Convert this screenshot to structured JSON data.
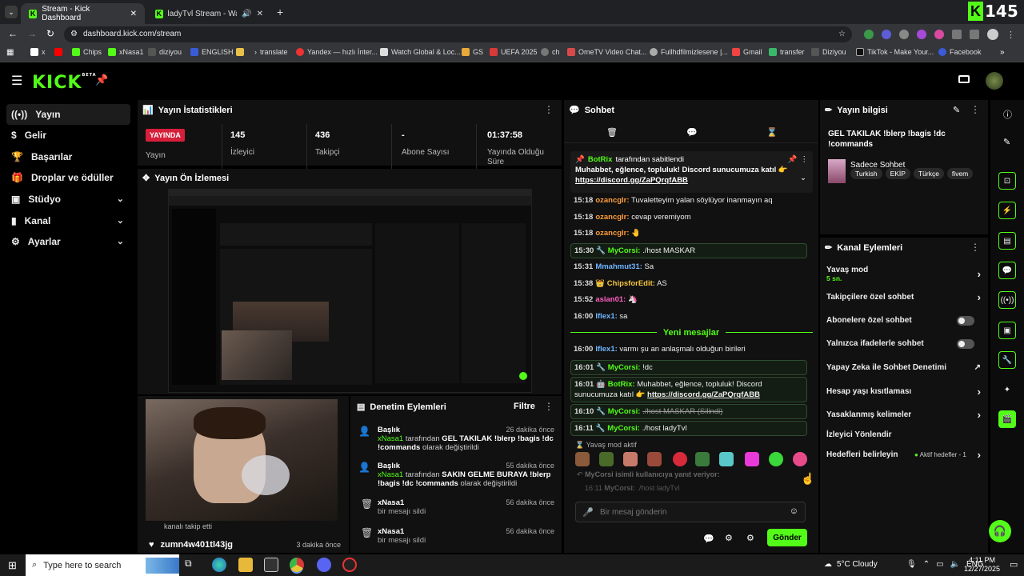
{
  "browser": {
    "tabs": [
      {
        "title": "Stream - Kick Dashboard"
      },
      {
        "title": "ladyTvl Stream - Watch Live"
      }
    ],
    "url": "dashboard.kick.com/stream",
    "bookmarks": [
      "x",
      "Chips",
      "xNasa1",
      "diziyou",
      "ENGLISH",
      "translate",
      "Yandex — hızlı İnter...",
      "Watch Global & Loc...",
      "GS",
      "UEFA 2025",
      "ch",
      "OmeTV Video Chat...",
      "Fullhdfilmizlesene |...",
      "Gmail",
      "transfer",
      "Diziyou",
      "TikTok - Make Your...",
      "Facebook"
    ],
    "viewer_overlay": "145"
  },
  "header": {
    "logo": "KICK",
    "logo_sup": "BETA"
  },
  "nav": {
    "items": [
      {
        "label": "Yayın"
      },
      {
        "label": "Gelir"
      },
      {
        "label": "Başarılar"
      },
      {
        "label": "Droplar ve ödüller"
      },
      {
        "label": "Stüdyo"
      },
      {
        "label": "Kanal"
      },
      {
        "label": "Ayarlar"
      }
    ]
  },
  "stats": {
    "title": "Yayın İstatistikleri",
    "live_badge": "YAYINDA",
    "live_label": "Yayın",
    "cols": [
      {
        "value": "145",
        "label": "İzleyici"
      },
      {
        "value": "436",
        "label": "Takipçi"
      },
      {
        "value": "-",
        "label": "Abone Sayısı"
      },
      {
        "value": "01:37:58",
        "label": "Yayında Olduğu Süre"
      }
    ]
  },
  "preview": {
    "title": "Yayın Ön İzlemesi"
  },
  "feed": {
    "follow_text": "kanalı takip etti",
    "follower": "zumn4w401tl43jg",
    "time": "3 dakika önce"
  },
  "moderation": {
    "title": "Denetim Eylemleri",
    "filter": "Filtre",
    "rows": [
      {
        "head": "Başlık",
        "time": "26 dakika önce",
        "user": "xNasa1",
        "pre": "tarafından",
        "text": "GEL TAKILAK !blerp !bagis !dc !commands",
        "post": "olarak değiştirildi"
      },
      {
        "head": "Başlık",
        "time": "55 dakika önce",
        "user": "xNasa1",
        "pre": "tarafından",
        "text": "SAKIN GELME BURAYA !blerp !bagis !dc !commands",
        "post": "olarak değiştirildi"
      },
      {
        "head": "xNasa1",
        "time": "56 dakika önce",
        "sub": "bir mesajı sildi"
      },
      {
        "head": "xNasa1",
        "time": "56 dakika önce",
        "sub": "bir mesajı sildi"
      }
    ]
  },
  "chat": {
    "title": "Sohbet",
    "pinned_user": "BotRix",
    "pinned_by": "tarafından sabitlendi",
    "pinned_text": "Muhabbet, eğlence, topluluk! Discord sunucumuza katıl 👉",
    "pinned_link": "https://discord.gg/ZaPQrqfABB",
    "messages": [
      {
        "time": "15:18",
        "user": "ozancglr:",
        "text": "Tuvaletteyim yalan söylüyor inanmayın aq"
      },
      {
        "time": "15:18",
        "user": "ozancglr:",
        "text": "cevap veremiyom"
      },
      {
        "time": "15:18",
        "user": "ozancglr:",
        "text": ""
      },
      {
        "time": "15:30",
        "user": "MyCorsi:",
        "text": "./host MASKAR"
      },
      {
        "time": "15:31",
        "user": "Mmahmut31:",
        "text": "Sa"
      },
      {
        "time": "15:38",
        "user": "ChipsforEdit:",
        "text": "AS"
      },
      {
        "time": "15:52",
        "user": "aslan01:",
        "text": ""
      },
      {
        "time": "16:00",
        "user": "Iflex1:",
        "text": "sa"
      }
    ],
    "new_messages": "Yeni mesajlar",
    "messages2": [
      {
        "time": "16:00",
        "user": "Iflex1:",
        "text": "varmı şu an anlaşmalı olduğun birileri"
      },
      {
        "time": "16:01",
        "user": "MyCorsi:",
        "text": "!dc"
      },
      {
        "time": "16:01",
        "user": "BotRix:",
        "text": "Muhabbet, eğlence, topluluk! Discord sunucumuza katıl 👉",
        "link": "https://discord.gg/ZaPQrqfABB"
      },
      {
        "time": "16:10",
        "user": "MyCorsi:",
        "text": "./host MASKAR (Silindi)"
      },
      {
        "time": "16:11",
        "user": "MyCorsi:",
        "text": "./host ladyTvl"
      }
    ],
    "slow_mode": "Yavaş mod aktif",
    "reply_to": "MyCorsi isimli kullanıcıya yanıt veriyor:",
    "reply_time": "16:11",
    "reply_user": "MyCorsi:",
    "reply_text": "./host ladyTvl",
    "input_placeholder": "Bir mesaj gönderin",
    "send": "Gönder"
  },
  "info": {
    "title": "Yayın bilgisi",
    "stream_title": "GEL TAKILAK !blerp !bagis !dc !commands",
    "category": "Sadece Sohbet",
    "tags": [
      "Turkish",
      "EKİP",
      "Türkçe",
      "fivem"
    ]
  },
  "channel_actions": {
    "title": "Kanal Eylemleri",
    "items": [
      {
        "label": "Yavaş mod",
        "sub": "5 sn."
      },
      {
        "label": "Takipçilere özel sohbet"
      },
      {
        "label": "Abonelere özel sohbet"
      },
      {
        "label": "Yalnızca ifadelerle sohbet"
      },
      {
        "label": "Yapay Zeka ile Sohbet Denetimi"
      },
      {
        "label": "Hesap yaşı kısıtlaması"
      },
      {
        "label": "Yasaklanmış kelimeler"
      },
      {
        "label": "İzleyici Yönlendir"
      },
      {
        "label": "Hedefleri belirleyin",
        "extra": "Aktif hedefler - 1"
      }
    ]
  },
  "taskbar": {
    "search": "Type here to search",
    "weather": "5°C Cloudy",
    "lang": "ENG",
    "time": "4:11 PM",
    "date": "12/27/2025"
  },
  "colors": {
    "accent": "#53fc18",
    "live": "#d61f3a",
    "panel": "#111111"
  }
}
